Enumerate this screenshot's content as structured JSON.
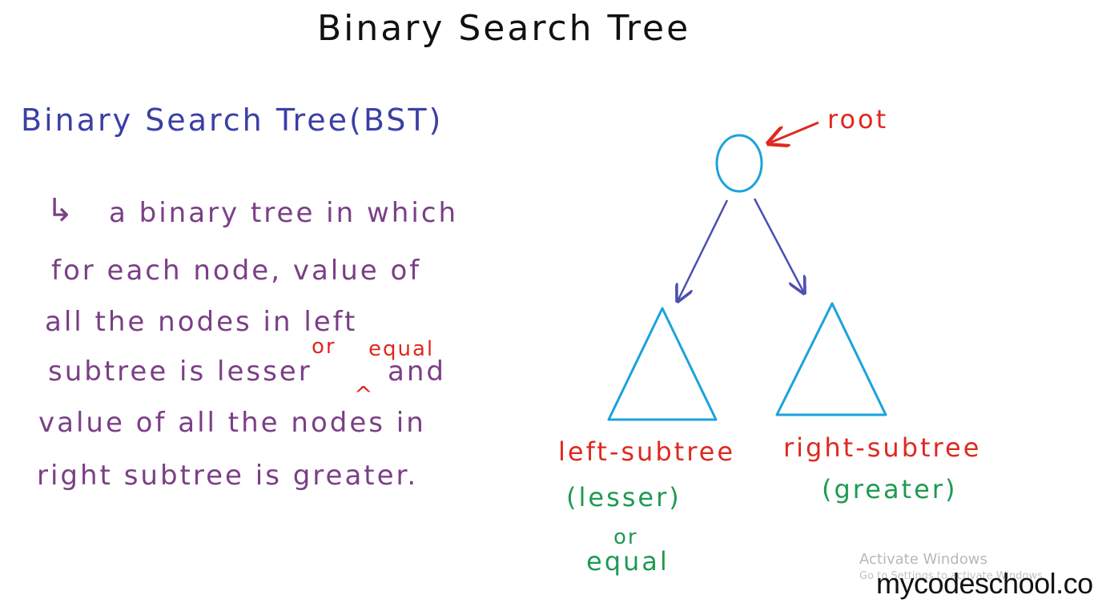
{
  "title": "Binary Search Tree",
  "heading": "Binary Search Tree(BST)",
  "definition": {
    "lines": [
      "a binary tree in which",
      "for each node, value of",
      "all the nodes in left",
      "subtree is lesser",
      "value of all the nodes in",
      "right subtree is greater."
    ],
    "and_word": "and",
    "insert_or": "or",
    "insert_equal": "equal",
    "caret": "^",
    "arrow_glyph": "↳"
  },
  "diagram": {
    "root_label": "root",
    "left_label": "left-subtree",
    "left_desc": "(lesser)",
    "left_or": "or",
    "left_equal": "equal",
    "right_label": "right-subtree",
    "right_desc": "(greater)"
  },
  "watermark": {
    "title": "Activate Windows",
    "subtitle": "Go to Settings to activate Windows."
  },
  "brand": "mycodeschool.com",
  "colors": {
    "title": "#111111",
    "heading": "#3b3fa5",
    "definition": "#7b3f86",
    "annotation": "#e0281f",
    "node": "#1aa3dc",
    "edge": "#4b4fb0",
    "green": "#1f9a52"
  }
}
